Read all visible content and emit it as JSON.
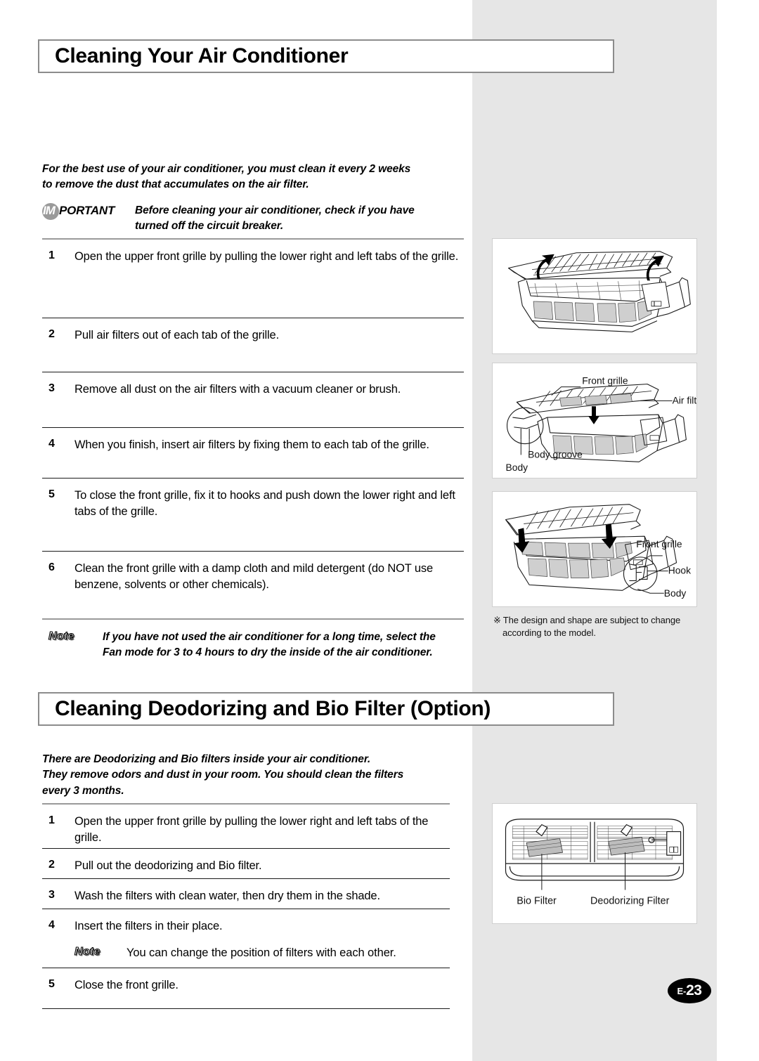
{
  "page": {
    "number_prefix": "E-",
    "number": "23"
  },
  "section1": {
    "heading": "Cleaning Your Air Conditioner",
    "intro_line1": "For the best use of your air conditioner, you must clean it every 2 weeks",
    "intro_line2": "to remove the dust that accumulates on the air filter.",
    "important": {
      "label_circle": "IM",
      "label_rest": "PORTANT",
      "text_line1": "Before cleaning your air conditioner, check if you have",
      "text_line2": "turned off the circuit breaker."
    },
    "steps": [
      {
        "num": "1",
        "text": "Open the upper front grille by pulling the lower right and left tabs of the grille."
      },
      {
        "num": "2",
        "text": "Pull air filters out of each tab of the grille."
      },
      {
        "num": "3",
        "text": "Remove all dust on the air filters with a vacuum cleaner or brush."
      },
      {
        "num": "4",
        "text": "When you finish, insert air filters by fixing them to each tab of the grille."
      },
      {
        "num": "5",
        "text": "To close the front grille, fix it to hooks and push down the lower right and left tabs of the grille."
      },
      {
        "num": "6",
        "text": "Clean the front grille with a damp cloth and mild detergent (do NOT use benzene, solvents or other chemicals)."
      }
    ],
    "note": {
      "label": "Note",
      "text_line1": "If you have not used the air conditioner for a long time, select the",
      "text_line2": "Fan mode for 3 to 4 hours to dry the inside of the air conditioner."
    }
  },
  "section2": {
    "heading": "Cleaning Deodorizing and Bio Filter (Option)",
    "intro_line1": "There are Deodorizing and Bio filters inside your air conditioner.",
    "intro_line2": "They remove odors and dust in your room. You should clean the filters",
    "intro_line3": "every 3 months.",
    "steps": [
      {
        "num": "1",
        "text": "Open the upper front grille by pulling the lower right and left tabs of the grille."
      },
      {
        "num": "2",
        "text": "Pull out the deodorizing and Bio filter."
      },
      {
        "num": "3",
        "text": "Wash the filters with clean water, then dry them in the shade."
      },
      {
        "num": "4",
        "text": "Insert the filters in their place."
      },
      {
        "num": "5",
        "text": "Close the front grille."
      }
    ],
    "note": {
      "label": "Note",
      "text": "You can change the position of filters with each other."
    }
  },
  "figures": {
    "fig1": {
      "name": "open-front-grille-diagram"
    },
    "fig2": {
      "name": "front-grille-air-filter-diagram",
      "labels": {
        "front_grille": "Front grille",
        "air_filter": "Air filter",
        "body_groove": "Body groove",
        "body": "Body"
      }
    },
    "fig3": {
      "name": "close-front-grille-hook-diagram",
      "labels": {
        "front_grille": "Front grille",
        "hook": "Hook",
        "body": "Body"
      }
    },
    "fig4": {
      "name": "bio-deodorizing-filter-diagram",
      "labels": {
        "bio_filter": "Bio Filter",
        "deodorizing_filter": "Deodorizing Filter"
      }
    }
  },
  "design_note": {
    "star": "※",
    "line1": "The design and shape are subject to change",
    "line2": "according to the model."
  },
  "colors": {
    "band": "#e6e6e6",
    "heading_border": "#8c8c8c",
    "rule": "#1a1a1a",
    "badge": "#000000"
  }
}
